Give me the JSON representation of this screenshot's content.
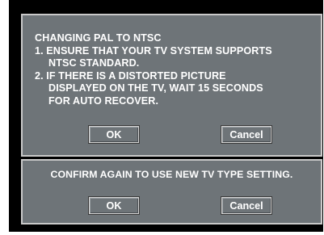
{
  "dialog_top": {
    "title": "CHANGING PAL TO NTSC",
    "line1": "1. ENSURE THAT YOUR TV SYSTEM SUPPORTS",
    "line1_cont": "NTSC STANDARD.",
    "line2": "2. IF THERE IS A DISTORTED PICTURE",
    "line2_cont": "DISPLAYED ON THE TV, WAIT 15 SECONDS",
    "line2_cont2": "FOR AUTO RECOVER.",
    "ok_label": "OK",
    "cancel_label": "Cancel"
  },
  "dialog_bottom": {
    "message": "CONFIRM AGAIN TO USE NEW TV TYPE SETTING.",
    "ok_label": "OK",
    "cancel_label": "Cancel"
  },
  "colors": {
    "screen_background": "#000000",
    "dialog_background": "#6e7478",
    "dialog_border": "#c9c9c9",
    "text": "#ffffff"
  }
}
